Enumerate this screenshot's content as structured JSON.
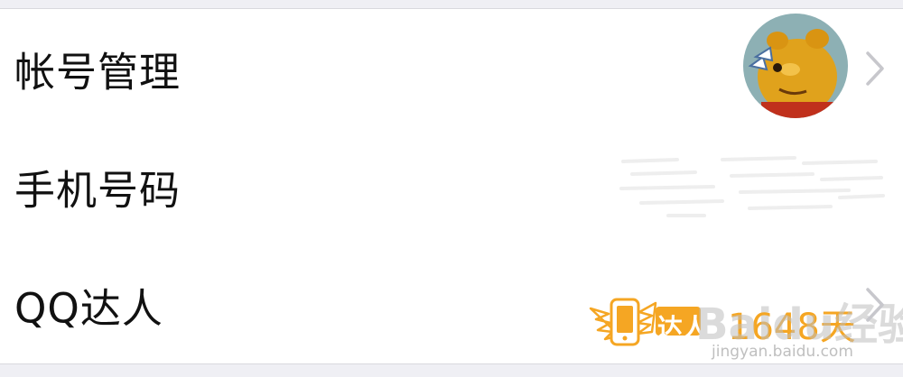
{
  "rows": [
    {
      "label": "帐号管理"
    },
    {
      "label": "手机号码"
    },
    {
      "label": "QQ达人",
      "badge_text": "达人",
      "days": "1648天"
    }
  ],
  "watermark": {
    "logo": "Baidu经验",
    "url": "jingyan.baidu.com"
  },
  "colors": {
    "badge": "#f5a623",
    "chevron": "#c7c7cc",
    "divider": "#d9d9de"
  }
}
